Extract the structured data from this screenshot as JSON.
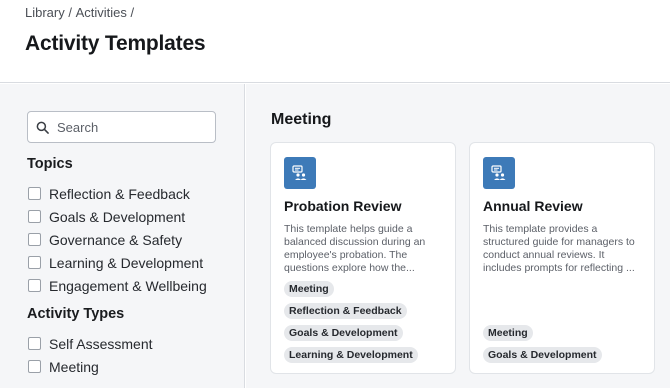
{
  "breadcrumb": {
    "items": [
      "Library",
      "Activities"
    ],
    "separator": " / "
  },
  "page": {
    "title": "Activity Templates"
  },
  "sidebar": {
    "search": {
      "placeholder": "Search",
      "value": ""
    },
    "topics": {
      "title": "Topics",
      "items": [
        "Reflection & Feedback",
        "Goals & Development",
        "Governance & Safety",
        "Learning & Development",
        "Engagement & Wellbeing"
      ]
    },
    "activity_types": {
      "title": "Activity Types",
      "items": [
        "Self Assessment",
        "Meeting"
      ]
    }
  },
  "main": {
    "section_title": "Meeting",
    "cards": [
      {
        "title": "Probation Review",
        "description": "This template helps guide a balanced discussion during an employee's probation. The questions explore how the...",
        "icon": "meeting-template-icon",
        "tags": [
          "Meeting",
          "Reflection & Feedback",
          "Goals & Development",
          "Learning & Development"
        ]
      },
      {
        "title": "Annual Review",
        "description": "This template provides a structured guide for managers to conduct annual reviews. It includes prompts for reflecting ...",
        "icon": "meeting-template-icon",
        "tags": [
          "Meeting",
          "Goals & Development"
        ]
      }
    ]
  },
  "colors": {
    "accent": "#3d7ab8",
    "panel_bg": "#f5f6f8",
    "tag_bg": "#e6e8eb"
  }
}
